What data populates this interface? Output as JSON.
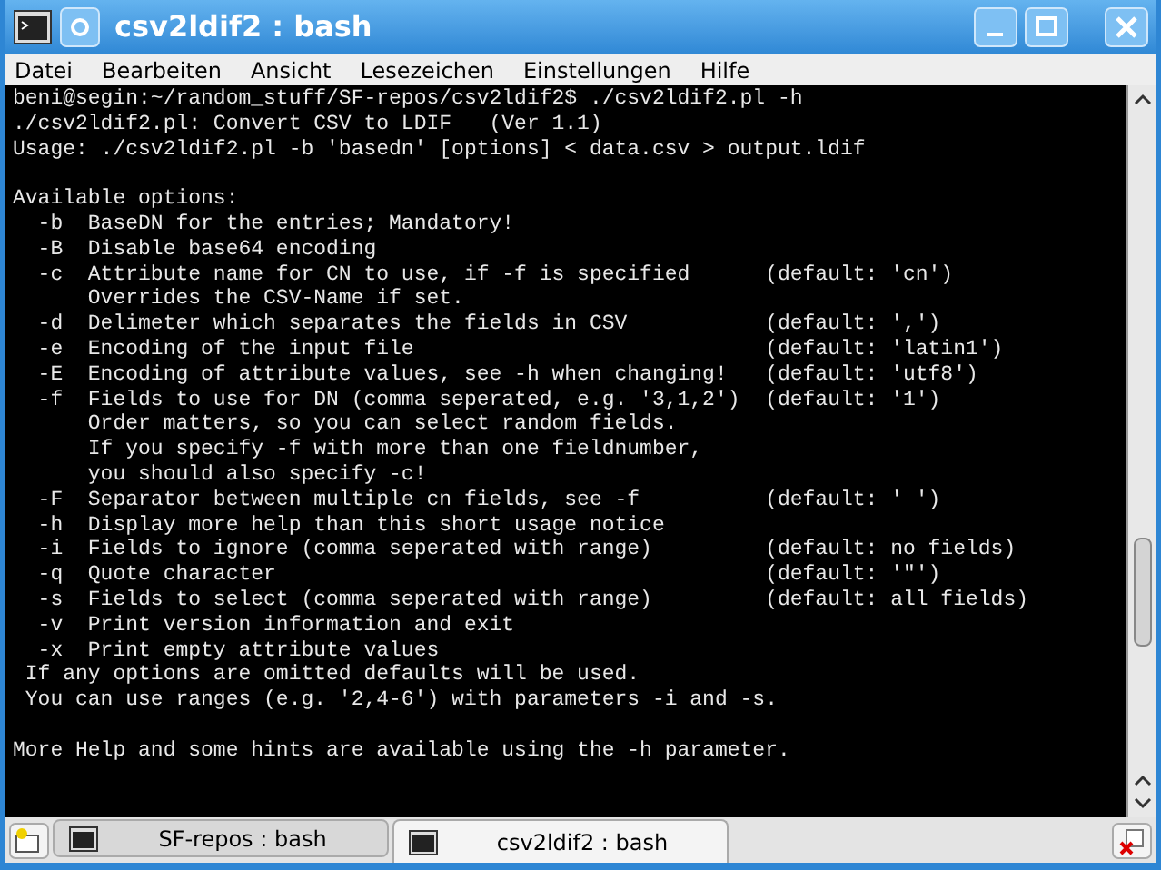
{
  "window": {
    "title": "csv2ldif2 : bash"
  },
  "menu": [
    "Datei",
    "Bearbeiten",
    "Ansicht",
    "Lesezeichen",
    "Einstellungen",
    "Hilfe"
  ],
  "terminal": {
    "blocks": [
      [
        "beni@segin:~/random_stuff/SF-repos/csv2ldif2$ ./csv2ldif2.pl -h",
        "./csv2ldif2.pl: Convert CSV to LDIF   (Ver 1.1)",
        "Usage: ./csv2ldif2.pl -b 'basedn' [options] < data.csv > output.ldif"
      ],
      [
        "Available options:",
        "  -b  BaseDN for the entries; Mandatory!",
        "  -B  Disable base64 encoding",
        "  -c  Attribute name for CN to use, if -f is specified      (default: 'cn')",
        "      Overrides the CSV-Name if set.",
        "  -d  Delimeter which separates the fields in CSV           (default: ',')",
        "  -e  Encoding of the input file                            (default: 'latin1')",
        "  -E  Encoding of attribute values, see -h when changing!   (default: 'utf8')",
        "  -f  Fields to use for DN (comma seperated, e.g. '3,1,2')  (default: '1')",
        "      Order matters, so you can select random fields.",
        "      If you specify -f with more than one fieldnumber,",
        "      you should also specify -c!",
        "  -F  Separator between multiple cn fields, see -f          (default: ' ')",
        "  -h  Display more help than this short usage notice",
        "  -i  Fields to ignore (comma seperated with range)         (default: no fields)",
        "  -q  Quote character                                       (default: '\"')",
        "  -s  Fields to select (comma seperated with range)         (default: all fields)",
        "  -v  Print version information and exit",
        "  -x  Print empty attribute values",
        " If any options are omitted defaults will be used.",
        " You can use ranges (e.g. '2,4-6') with parameters -i and -s."
      ],
      [
        "More Help and some hints are available using the -h parameter."
      ]
    ]
  },
  "tabs": [
    {
      "label": "SF-repos : bash",
      "selected": false
    },
    {
      "label": "csv2ldif2 : bash",
      "selected": true
    }
  ]
}
